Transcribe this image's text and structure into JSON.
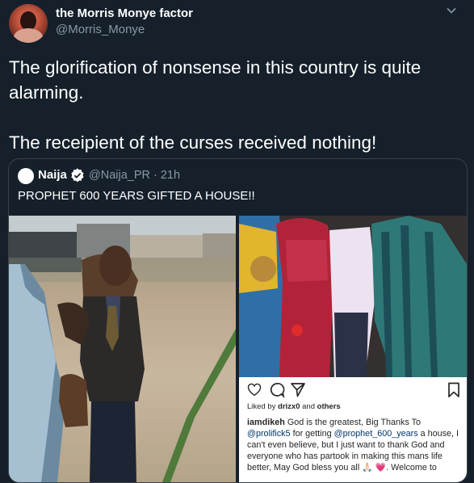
{
  "author": {
    "name": "the Morris Monye factor",
    "handle": "@Morris_Monye"
  },
  "tweet": {
    "line1": "The glorification of nonsense in this country is quite alarming.",
    "line2": "The receipient of the curses received nothing!"
  },
  "quoted": {
    "name": "Naija",
    "meta": "@Naija_PR · 21h",
    "text": "PROPHET 600 YEARS GIFTED A HOUSE!!"
  },
  "instagram": {
    "liked_prefix": "Liked by",
    "liked_user": "drizx0",
    "liked_mid": "and",
    "liked_others": "others",
    "caption_user": "iamdikeh",
    "caption_part1": "God is the greatest, Big Thanks To",
    "mention1": "@prolifick5",
    "caption_part2": "for getting",
    "mention2": "@prophet_600_years",
    "caption_part3": "a house, I can't even believe, but I just want to thank God and everyone who has partook in making this mans life better, May God bless you all",
    "caption_emoji": "🙏🏻 💗.",
    "caption_part4": "Welcome to"
  },
  "icons": {
    "chevron": "chevron-down-icon",
    "verified": "verified-badge-icon",
    "comment": "comment-icon",
    "share": "share-icon",
    "bookmark": "bookmark-icon"
  },
  "colors": {
    "background": "#15202b",
    "secondary_text": "#8899a6",
    "border": "#38444d",
    "ig_mention": "#00376b"
  }
}
